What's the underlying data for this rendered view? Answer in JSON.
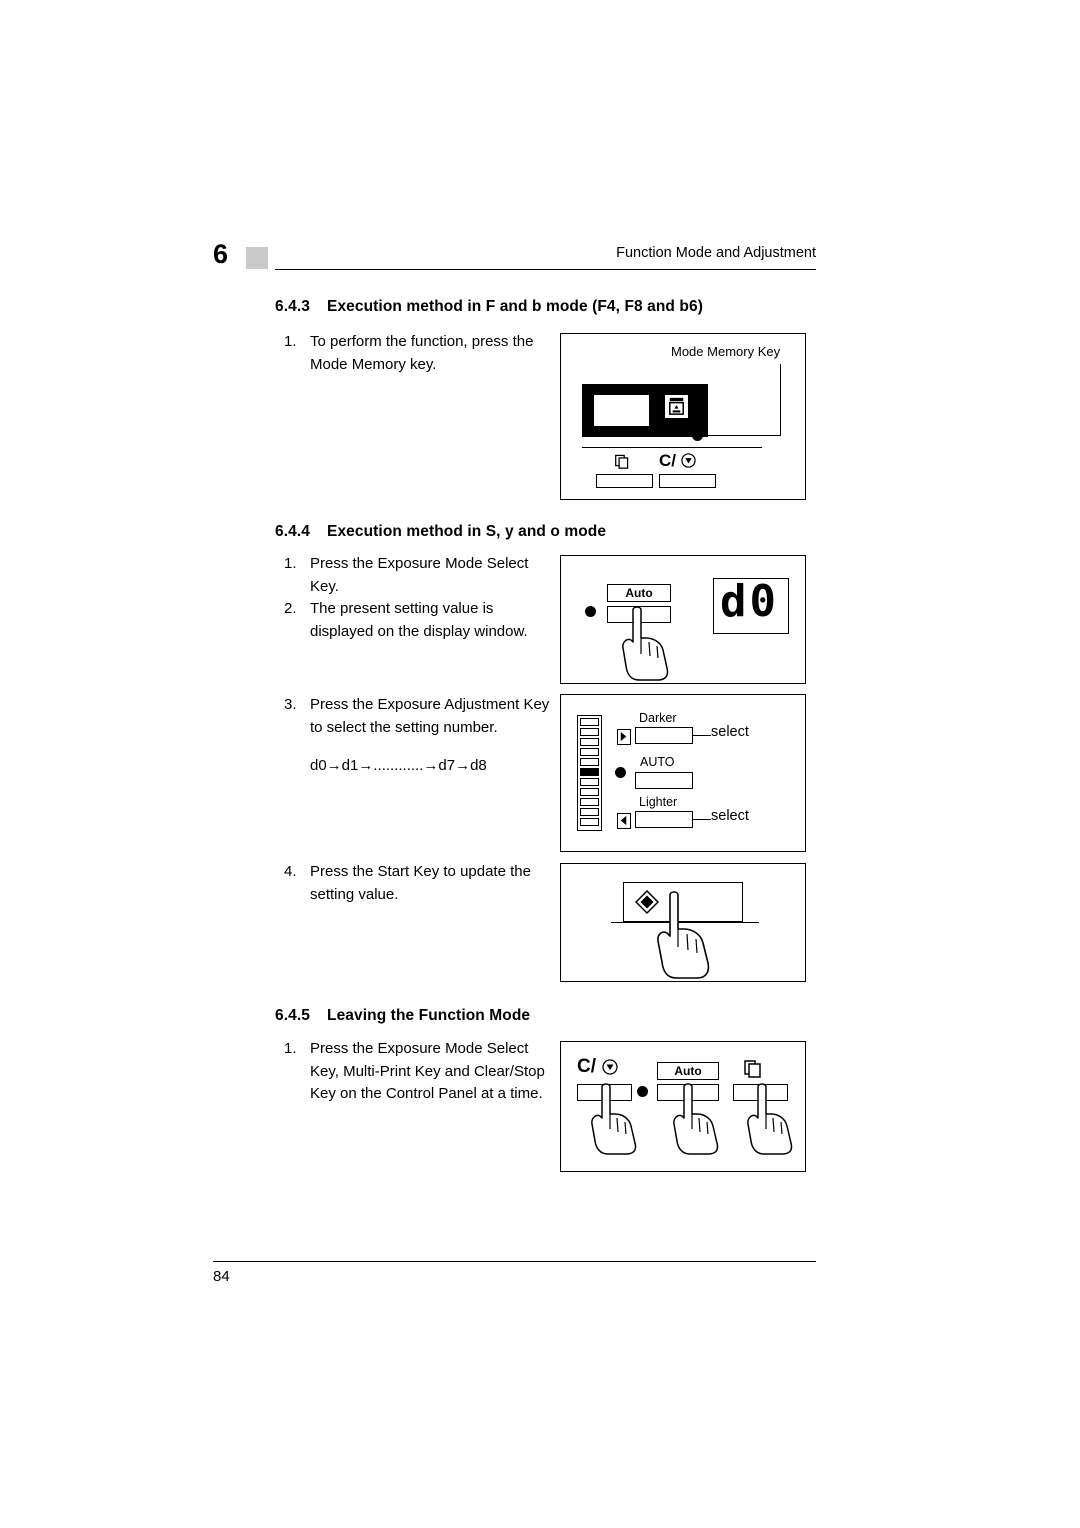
{
  "header": {
    "chapter_number": "6",
    "title": "Function Mode and Adjustment"
  },
  "sections": [
    {
      "number": "6.4.3",
      "title": "Execution method in F and b mode (F4, F8 and b6)",
      "steps": [
        {
          "num": "1.",
          "text": "To perform the function, press the Mode Memory key."
        }
      ]
    },
    {
      "number": "6.4.4",
      "title": "Execution method in S, y and o mode",
      "steps": [
        {
          "num": "1.",
          "text": "Press the Exposure Mode Select Key."
        },
        {
          "num": "2.",
          "text": "The present setting value is displayed on the display window."
        },
        {
          "num": "3.",
          "text": "Press the Exposure Adjustment Key to select the setting number."
        },
        {
          "num": "4.",
          "text": "Press the Start Key to update the setting value."
        }
      ],
      "sequence": "d0→d1→............→d7→d8"
    },
    {
      "number": "6.4.5",
      "title": "Leaving the Function Mode",
      "steps": [
        {
          "num": "1.",
          "text": "Press the Exposure Mode Select Key, Multi-Print Key and Clear/Stop Key on the Control Panel at a time."
        }
      ]
    }
  ],
  "figures": {
    "mode_memory": {
      "callout": "Mode Memory Key",
      "clear_stop_label": "C/",
      "multiprint_icon": "multi-print-icon",
      "mode_memory_icon": "mode-memory-icon"
    },
    "exposure_select": {
      "auto_label": "Auto",
      "display_value": "d0"
    },
    "exposure_adjust": {
      "darker_label": "Darker",
      "auto_label": "AUTO",
      "lighter_label": "Lighter",
      "select_label_top": "select",
      "select_label_bottom": "select"
    },
    "start_key": {
      "icon": "start-key-icon"
    },
    "leaving": {
      "clear_stop_label": "C/",
      "auto_label": "Auto",
      "multiprint_icon": "multi-print-icon"
    }
  },
  "footer": {
    "page_number": "84"
  }
}
